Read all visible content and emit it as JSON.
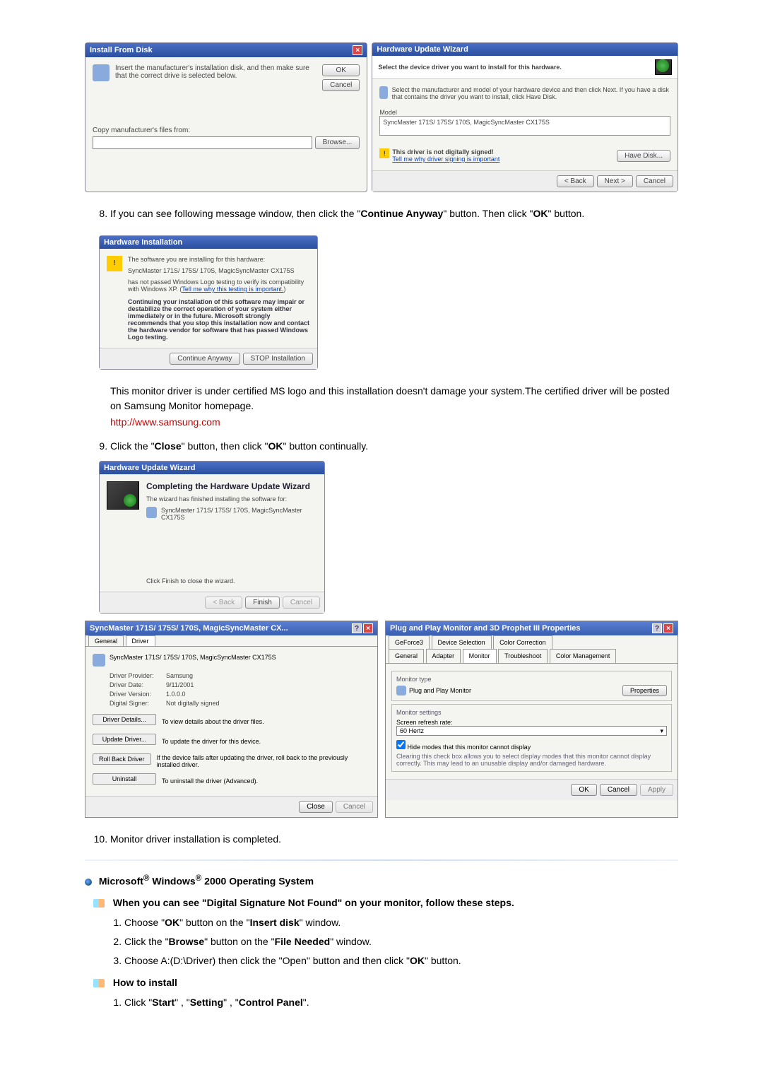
{
  "dialog1": {
    "title": "Install From Disk",
    "instruction": "Insert the manufacturer's installation disk, and then make sure that the correct drive is selected below.",
    "ok": "OK",
    "cancel": "Cancel",
    "copy_from": "Copy manufacturer's files from:",
    "browse": "Browse..."
  },
  "dialog2": {
    "title": "Hardware Update Wizard",
    "subtitle": "Select the device driver you want to install for this hardware.",
    "instruction": "Select the manufacturer and model of your hardware device and then click Next. If you have a disk that contains the driver you want to install, click Have Disk.",
    "model_label": "Model",
    "model_item": "SyncMaster 171S/ 175S/ 170S, MagicSyncMaster CX175S",
    "unsigned_text": "This driver is not digitally signed!",
    "unsigned_link": "Tell me why driver signing is important",
    "have_disk": "Have Disk...",
    "back": "< Back",
    "next": "Next >",
    "cancel": "Cancel"
  },
  "step8": {
    "num": "8.",
    "text_before": "If you can see following message window, then click the \"",
    "btn1": "Continue Anyway",
    "text_mid": "\" button. Then click \"",
    "btn2": "OK",
    "text_after": "\" button."
  },
  "hw_install": {
    "title": "Hardware Installation",
    "line1": "The software you are installing for this hardware:",
    "device": "SyncMaster 171S/ 175S/ 170S, MagicSyncMaster CX175S",
    "line2a": "has not passed Windows Logo testing to verify its compatibility with Windows XP. (",
    "line2_link": "Tell me why this testing is important.",
    "line2b": ")",
    "warning_bold": "Continuing your installation of this software may impair or destabilize the correct operation of your system either immediately or in the future. Microsoft strongly recommends that you stop this installation now and contact the hardware vendor for software that has passed Windows Logo testing.",
    "continue": "Continue Anyway",
    "stop": "STOP Installation"
  },
  "cert_note": "This monitor driver is under certified MS logo and this installation doesn't damage your system.The certified driver will be posted on Samsung Monitor homepage.",
  "cert_link": "http://www.samsung.com",
  "step9": {
    "num": "9.",
    "text": "Click the \"Close\" button, then click \"OK\" button continually."
  },
  "wizard_complete": {
    "title": "Hardware Update Wizard",
    "heading": "Completing the Hardware Update Wizard",
    "line": "The wizard has finished installing the software for:",
    "device": "SyncMaster 171S/ 175S/ 170S, MagicSyncMaster CX175S",
    "finish_hint": "Click Finish to close the wizard.",
    "back": "< Back",
    "finish": "Finish",
    "cancel": "Cancel"
  },
  "props": {
    "title": "SyncMaster 171S/ 175S/ 170S, MagicSyncMaster CX...",
    "tabs": {
      "general": "General",
      "driver": "Driver"
    },
    "device": "SyncMaster 171S/ 175S/ 170S, MagicSyncMaster CX175S",
    "provider_label": "Driver Provider:",
    "provider": "Samsung",
    "date_label": "Driver Date:",
    "date": "9/11/2001",
    "version_label": "Driver Version:",
    "version": "1.0.0.0",
    "signer_label": "Digital Signer:",
    "signer": "Not digitally signed",
    "btn_details": "Driver Details...",
    "details_desc": "To view details about the driver files.",
    "btn_update": "Update Driver...",
    "update_desc": "To update the driver for this device.",
    "btn_rollback": "Roll Back Driver",
    "rollback_desc": "If the device fails after updating the driver, roll back to the previously installed driver.",
    "btn_uninstall": "Uninstall",
    "uninstall_desc": "To uninstall the driver (Advanced).",
    "close": "Close",
    "cancel": "Cancel"
  },
  "pnp": {
    "title": "Plug and Play Monitor and 3D Prophet III Properties",
    "tabs": {
      "geforce": "GeForce3",
      "devsel": "Device Selection",
      "colorcor": "Color Correction",
      "general": "General",
      "adapter": "Adapter",
      "monitor": "Monitor",
      "trouble": "Troubleshoot",
      "colormgmt": "Color Management"
    },
    "monitor_type_label": "Monitor type",
    "monitor_type": "Plug and Play Monitor",
    "properties": "Properties",
    "monitor_settings_label": "Monitor settings",
    "refresh_label": "Screen refresh rate:",
    "refresh_val": "60 Hertz",
    "hide_check": "Hide modes that this monitor cannot display",
    "hide_desc": "Clearing this check box allows you to select display modes that this monitor cannot display correctly. This may lead to an unusable display and/or damaged hardware.",
    "ok": "OK",
    "cancel": "Cancel",
    "apply": "Apply"
  },
  "step10": {
    "num": "10.",
    "text": "Monitor driver installation is completed."
  },
  "win2000_heading": "Microsoft",
  "win2000_heading2": " Windows",
  "win2000_heading3": " 2000 Operating System",
  "dsnf_heading": "When you can see \"Digital Signature Not Found\" on your monitor, follow these steps.",
  "dsnf_steps": [
    "Choose \"OK\" button on the \"Insert disk\" window.",
    "Click the \"Browse\" button on the \"File Needed\" window.",
    "Choose A:(D:\\Driver) then click the \"Open\" button and then click \"OK\" button."
  ],
  "howto_heading": "How to install",
  "howto_step1": "Click \"Start\" , \"Setting\" , \"Control Panel\"."
}
